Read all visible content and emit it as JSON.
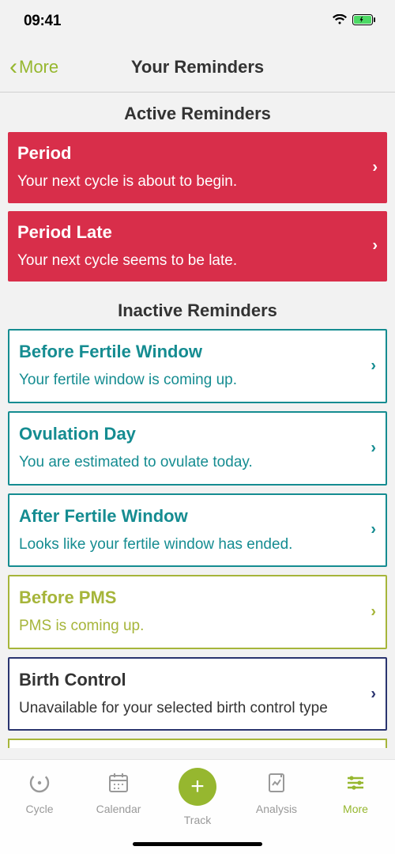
{
  "status": {
    "time": "09:41"
  },
  "nav": {
    "back_label": "More",
    "title": "Your Reminders"
  },
  "sections": {
    "active_title": "Active Reminders",
    "inactive_title": "Inactive Reminders"
  },
  "active_reminders": [
    {
      "title": "Period",
      "subtitle": "Your next cycle is about to begin."
    },
    {
      "title": "Period Late",
      "subtitle": "Your next cycle seems to be late."
    }
  ],
  "inactive_reminders": [
    {
      "title": "Before Fertile Window",
      "subtitle": "Your fertile window is coming up.",
      "variant": "teal"
    },
    {
      "title": "Ovulation Day",
      "subtitle": "You are estimated to ovulate today.",
      "variant": "teal"
    },
    {
      "title": "After Fertile Window",
      "subtitle": "Looks like your fertile window has ended.",
      "variant": "teal"
    },
    {
      "title": "Before PMS",
      "subtitle": "PMS is coming up.",
      "variant": "olive"
    },
    {
      "title": "Birth Control",
      "subtitle": "Unavailable for your selected birth control type",
      "variant": "navy"
    }
  ],
  "tabs": {
    "cycle": "Cycle",
    "calendar": "Calendar",
    "track": "Track",
    "analysis": "Analysis",
    "more": "More"
  }
}
